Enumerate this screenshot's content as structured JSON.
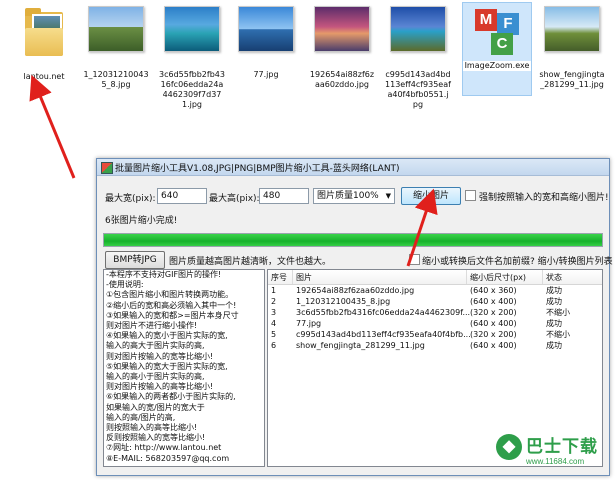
{
  "desktop": {
    "files": [
      {
        "name": "lantou.net",
        "kind": "folder"
      },
      {
        "name": "1_120312100435_8.jpg",
        "kind": "image"
      },
      {
        "name": "3c6d55fbb2fb4316fc06edda24a4462309f7d371.jpg",
        "kind": "image"
      },
      {
        "name": "77.jpg",
        "kind": "image"
      },
      {
        "name": "192654ai88zf6zaa60zddo.jpg",
        "kind": "image"
      },
      {
        "name": "c995d143ad4bd113eff4cf935eafa40f4bfb0551.jpg",
        "kind": "image"
      },
      {
        "name": "ImageZoom.exe",
        "kind": "app"
      },
      {
        "name": "show_fengjingta_281299_11.jpg",
        "kind": "image"
      }
    ],
    "app_icon_letters": [
      "M",
      "F",
      "C"
    ]
  },
  "window": {
    "title": "批量图片缩小工具V1.08,JPG|PNG|BMP图片缩小工具-蓝头网络(LANT)",
    "max_width_label": "最大宽(pix):",
    "max_width_value": "640",
    "max_height_label": "最大高(pix):",
    "max_height_value": "480",
    "quality_select": "图片质量100%",
    "shrink_button": "缩小图片",
    "force_checkbox_label": "强制按照输入的宽和高缩小图片!",
    "status_text": "6张图片缩小完成!",
    "progress_fraction": 1.0,
    "bmp_button": "BMP转JPG",
    "quality_hint": "图片质量越高图片越清晰，文件也越大。",
    "rename_checkbox_label": "缩小或转换后文件名加前缀? 缩小/转换图片列表",
    "instructions": [
      "-本程序不支持对GIF图片的操作!",
      "-使用说明:",
      "①包含图片缩小和图片转换两功能。",
      "②缩小后的宽和高必须输入其中一个!",
      "③如果输入的宽和都>=图片本身尺寸",
      "   则对图片不进行缩小操作!",
      "④如果输入的宽小于图片实际的宽,",
      "   输入的高大于图片实际的高,",
      "   则对图片按输入的宽等比缩小!",
      "⑤如果输入的宽大于图片实际的宽,",
      "   输入的高小于图片实际的高,",
      "   则对图片按输入的高等比缩小!",
      "⑥如果输入的两者都小于图片实际的,",
      "   如果输入的宽/图片的宽大于",
      "   输入的高/图片的高,",
      "   则按照输入的高等比缩小!",
      "   反则按照输入的宽等比缩小!",
      "⑦网址: http://www.lantou.net",
      "⑧E-MAIL: 568203597@qq.com"
    ],
    "table": {
      "headers": [
        "序号",
        "图片",
        "缩小后尺寸(px)",
        "状态"
      ],
      "rows": [
        [
          "1",
          "192654ai88zf6zaa60zddo.jpg",
          "(640 x 360)",
          "成功"
        ],
        [
          "2",
          "1_120312100435_8.jpg",
          "(640 x 400)",
          "成功"
        ],
        [
          "3",
          "3c6d55fbb2fb4316fc06edda24a4462309f...",
          "(320 x 200)",
          "不缩小"
        ],
        [
          "4",
          "77.jpg",
          "(640 x 400)",
          "成功"
        ],
        [
          "5",
          "c995d143ad4bd113eff4cf935eafa40f4bfb...",
          "(320 x 200)",
          "不缩小"
        ],
        [
          "6",
          "show_fengjingta_281299_11.jpg",
          "(640 x 400)",
          "成功"
        ]
      ]
    }
  },
  "watermark": {
    "name": "巴士下载",
    "url": "www.11684.com"
  },
  "colors": {
    "progress": "#17b22c",
    "annotation_arrow": "#e0201c",
    "watermark": "#2e9e4a"
  }
}
